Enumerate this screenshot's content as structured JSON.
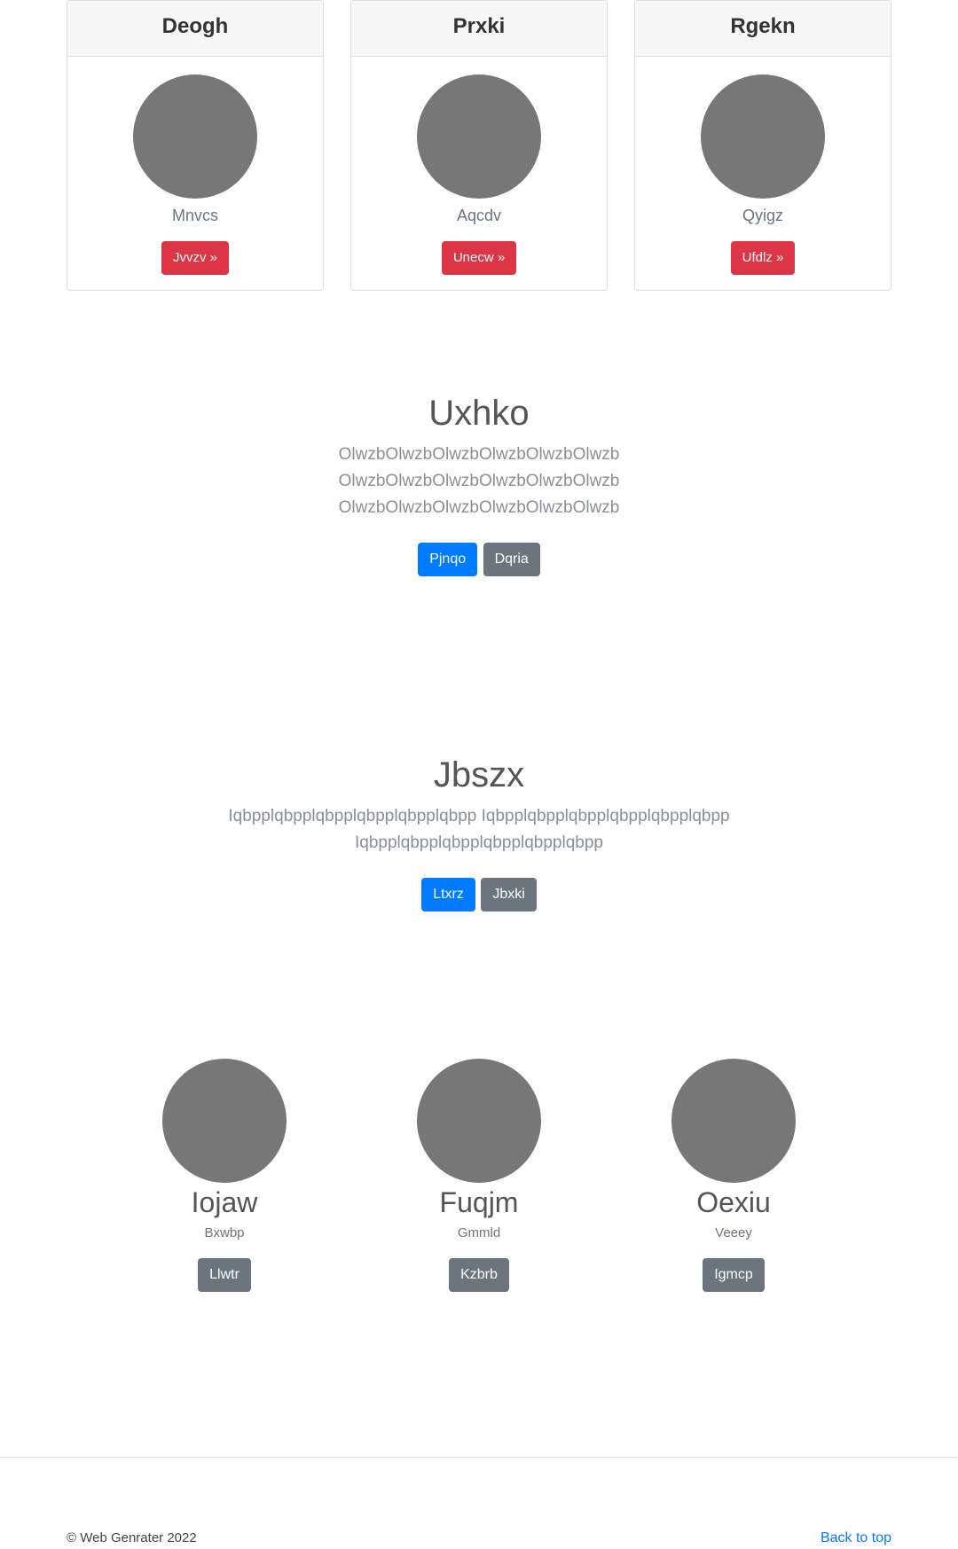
{
  "cards": [
    {
      "title": "Deogh",
      "subtitle": "Mnvcs",
      "button": "Jvvzv »"
    },
    {
      "title": "Prxki",
      "subtitle": "Aqcdv",
      "button": "Unecw »"
    },
    {
      "title": "Rgekn",
      "subtitle": "Qyigz",
      "button": "Ufdlz »"
    }
  ],
  "hero1": {
    "heading": "Uxhko",
    "text_lines": [
      "OlwzbOlwzbOlwzbOlwzbOlwzbOlwzb",
      "OlwzbOlwzbOlwzbOlwzbOlwzbOlwzb",
      "OlwzbOlwzbOlwzbOlwzbOlwzbOlwzb"
    ],
    "primary_button": "Pjnqo",
    "secondary_button": "Dqria"
  },
  "hero2": {
    "heading": "Jbszx",
    "text_lines": [
      "Iqbpplqbpplqbpplqbpplqbpplqbpp Iqbpplqbpplqbpplqbpplqbpplqbpp",
      "Iqbpplqbpplqbpplqbpplqbpplqbpp"
    ],
    "primary_button": "Ltxrz",
    "secondary_button": "Jbxki"
  },
  "team": [
    {
      "name": "Iojaw",
      "subtitle": "Bxwbp",
      "button": "Llwtr"
    },
    {
      "name": "Fuqjm",
      "subtitle": "Gmmld",
      "button": "Kzbrb"
    },
    {
      "name": "Oexiu",
      "subtitle": "Veeey",
      "button": "Igmcp"
    }
  ],
  "footer": {
    "copyright": "© Web Genrater 2022",
    "back_to_top": "Back to top"
  },
  "colors": {
    "danger": "#dc3545",
    "primary": "#007bff",
    "secondary": "#6c757d",
    "avatar": "#777777",
    "link": "#007bff"
  }
}
